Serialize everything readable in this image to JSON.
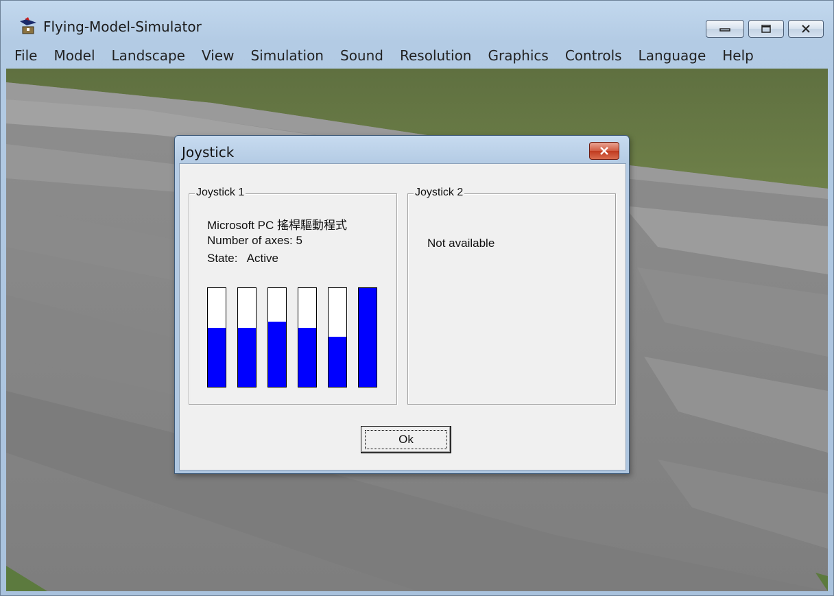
{
  "window": {
    "title": "Flying-Model-Simulator"
  },
  "menu": [
    "File",
    "Model",
    "Landscape",
    "View",
    "Simulation",
    "Sound",
    "Resolution",
    "Graphics",
    "Controls",
    "Language",
    "Help"
  ],
  "dialog": {
    "title": "Joystick",
    "joystick1": {
      "legend": "Joystick 1",
      "device": "Microsoft PC 搖桿驅動程式",
      "axes": "Number of axes: 5",
      "state_label": "State:",
      "state_value": "Active",
      "axis_levels": [
        0.6,
        0.6,
        0.66,
        0.6,
        0.51,
        1.0
      ]
    },
    "joystick2": {
      "legend": "Joystick 2",
      "status": "Not available"
    },
    "ok_label": "Ok"
  },
  "colors": {
    "bar_fill": "#0000ff",
    "grass": "#667a46",
    "ground": "#8d8d8d"
  }
}
